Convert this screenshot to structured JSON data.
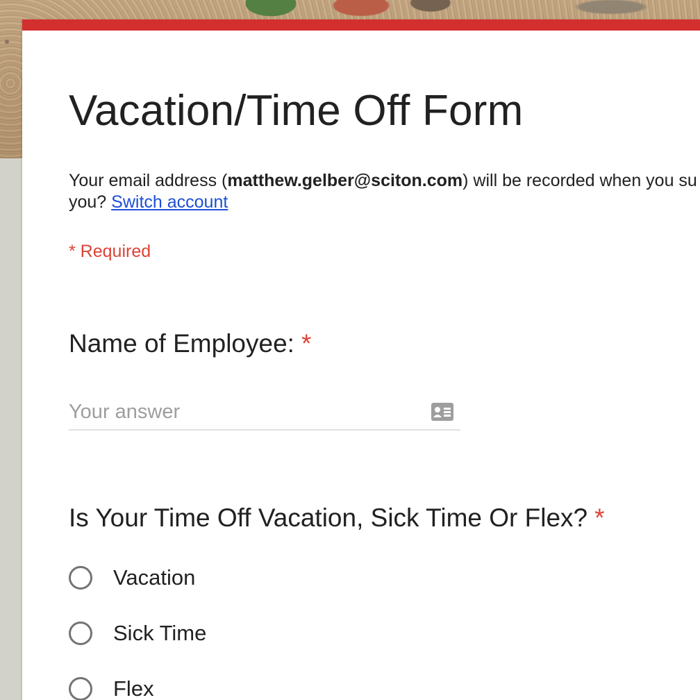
{
  "form": {
    "title": "Vacation/Time Off Form",
    "email_notice": {
      "prefix": "Your email address (",
      "email": "matthew.gelber@sciton.com",
      "suffix": ") will be recorded when you su",
      "line2_prefix": "you? ",
      "switch_account_link": "Switch account"
    },
    "required_note": "* Required",
    "accent_color": "#d32f2f",
    "required_color": "#db4437"
  },
  "questions": [
    {
      "title": "Name of Employee:",
      "required_mark": "*",
      "type": "short-answer",
      "placeholder": "Your answer",
      "icon": "contact-card-icon"
    },
    {
      "title": "Is Your Time Off Vacation, Sick Time Or Flex?",
      "required_mark": "*",
      "type": "radio",
      "options": [
        "Vacation",
        "Sick Time",
        "Flex"
      ]
    }
  ]
}
